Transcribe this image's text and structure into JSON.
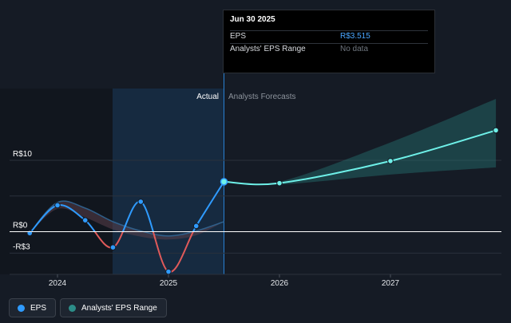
{
  "tooltip": {
    "title": "Jun 30 2025",
    "rows": [
      {
        "label": "EPS",
        "value": "R$3.515"
      },
      {
        "label": "Analysts' EPS Range",
        "value": "No data"
      }
    ]
  },
  "legend": [
    {
      "label": "EPS",
      "color": "#2f9bff"
    },
    {
      "label": "Analysts' EPS Range",
      "color": "#2c8d88"
    }
  ],
  "chart_data": {
    "type": "line",
    "ylim": [
      -3,
      10
    ],
    "y_tick_labels": [
      {
        "value": 10,
        "label": "R$10"
      },
      {
        "value": 0,
        "label": "R$0"
      },
      {
        "value": -3,
        "label": "-R$3"
      }
    ],
    "x_ticks": [
      {
        "value": 2024,
        "label": "2024"
      },
      {
        "value": 2025,
        "label": "2025"
      },
      {
        "value": 2026,
        "label": "2026"
      },
      {
        "value": 2027,
        "label": "2027"
      }
    ],
    "sections": {
      "actual_label": "Actual",
      "forecast_label": "Analysts Forecasts"
    },
    "series": [
      {
        "name": "EPS",
        "color": "#2f9bff",
        "negative_color": "#e05a5a",
        "x": [
          2023.75,
          2024.0,
          2024.25,
          2024.5,
          2024.75,
          2025.0,
          2025.25,
          2025.5
        ],
        "y": [
          -0.2,
          3.7,
          1.6,
          -2.2,
          4.2,
          -5.6,
          0.8,
          7.0
        ]
      },
      {
        "name": "EPS forecast",
        "color": "#6ef0e8",
        "x": [
          2025.5,
          2026.0,
          2027.0,
          2027.95
        ],
        "y": [
          7.0,
          6.8,
          9.9,
          14.2
        ]
      }
    ],
    "range_bands": [
      {
        "name": "Analysts' EPS Range (past)",
        "x": [
          2023.75,
          2024.0,
          2024.25,
          2024.5,
          2024.75,
          2025.0,
          2025.25,
          2025.5
        ],
        "low": [
          -0.2,
          3.2,
          2.0,
          0.3,
          -0.7,
          -1.1,
          -0.5,
          1.4
        ],
        "high": [
          -0.2,
          4.1,
          3.3,
          1.4,
          0.1,
          -0.6,
          0.1,
          1.4
        ]
      },
      {
        "name": "Analysts' EPS Range (forecast)",
        "x": [
          2025.5,
          2026.0,
          2027.0,
          2027.95
        ],
        "low": [
          7.0,
          6.6,
          8.0,
          9.0
        ],
        "high": [
          7.0,
          7.0,
          12.5,
          18.6
        ]
      }
    ]
  }
}
